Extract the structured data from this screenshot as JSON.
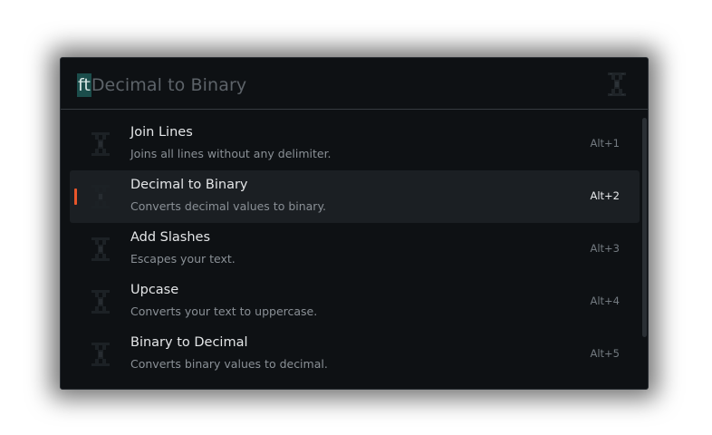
{
  "search": {
    "prefix": "ft",
    "value": "Decimal to Binary",
    "end_icon": "missing-icon"
  },
  "commands": [
    {
      "title": "Join Lines",
      "description": "Joins all lines without any delimiter.",
      "shortcut": "Alt+1",
      "icon": "missing-icon",
      "selected": false
    },
    {
      "title": "Decimal to Binary",
      "description": "Converts decimal values to binary.",
      "shortcut": "Alt+2",
      "icon": "missing-icon",
      "selected": true
    },
    {
      "title": "Add Slashes",
      "description": "Escapes your text.",
      "shortcut": "Alt+3",
      "icon": "missing-icon",
      "selected": false
    },
    {
      "title": "Upcase",
      "description": "Converts your text to uppercase.",
      "shortcut": "Alt+4",
      "icon": "missing-icon",
      "selected": false
    },
    {
      "title": "Binary to Decimal",
      "description": "Converts binary values to decimal.",
      "shortcut": "Alt+5",
      "icon": "missing-icon",
      "selected": false
    }
  ],
  "colors": {
    "background": "#0e1114",
    "selected_row": "#1b1f23",
    "accent_marker": "#e8552a",
    "search_prefix_bg": "#1b4d4b"
  }
}
